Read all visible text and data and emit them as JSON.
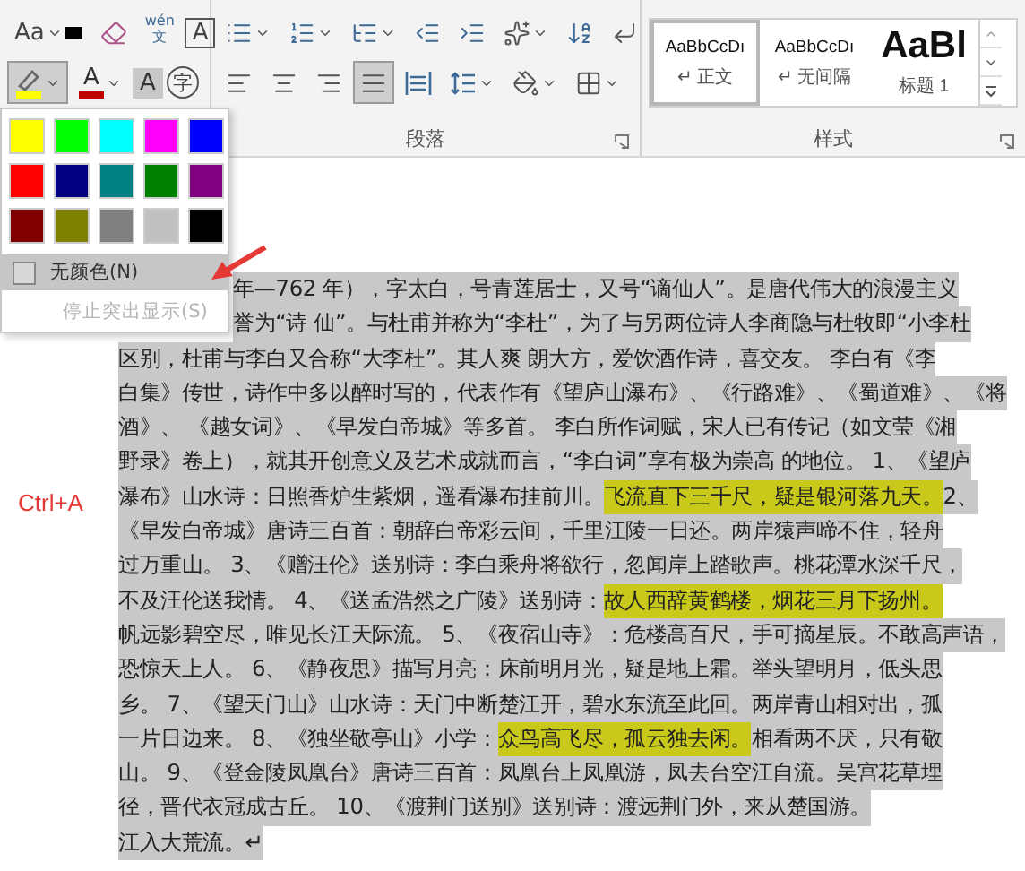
{
  "ribbon": {
    "font_rows": [
      [
        {
          "kind": "change-case",
          "label": "Aa"
        },
        {
          "kind": "clear-format"
        },
        {
          "kind": "phonetic",
          "label": "wén",
          "sub": "文"
        },
        {
          "kind": "boxed-letter",
          "label": "A"
        }
      ],
      [
        {
          "kind": "highlight",
          "pressed": true
        },
        {
          "kind": "font-color",
          "label": "A"
        },
        {
          "kind": "shaded-letter",
          "label": "A"
        },
        {
          "kind": "enclosed",
          "label": "字"
        }
      ]
    ],
    "paragraph_rows": [
      [
        {
          "kind": "bullets"
        },
        {
          "kind": "numbering"
        },
        {
          "kind": "multilevel"
        },
        {
          "kind": "outdent"
        },
        {
          "kind": "indent"
        },
        {
          "kind": "asian-layout"
        },
        {
          "kind": "sort"
        },
        {
          "kind": "marks"
        }
      ],
      [
        {
          "kind": "align-left",
          "selected": false
        },
        {
          "kind": "align-center",
          "selected": false
        },
        {
          "kind": "align-right",
          "selected": false
        },
        {
          "kind": "justify",
          "selected": true
        },
        {
          "kind": "distribute",
          "selected": false
        },
        {
          "kind": "line-spacing"
        },
        {
          "kind": "shading"
        },
        {
          "kind": "borders"
        }
      ]
    ],
    "paragraph_label": "段落",
    "styles": [
      {
        "preview": "AaBbCcDı",
        "name": "↵ 正文",
        "kind": "body",
        "selected": true
      },
      {
        "preview": "AaBbCcDı",
        "name": "↵ 无间隔",
        "kind": "body",
        "selected": false
      },
      {
        "preview": "AaBl",
        "name": "标题 1",
        "kind": "heading",
        "selected": false
      }
    ],
    "styles_label": "样式"
  },
  "highlight_menu": {
    "colors": [
      {
        "color": "#ffff00"
      },
      {
        "color": "#00ff00"
      },
      {
        "color": "#00ffff"
      },
      {
        "color": "#ff00ff"
      },
      {
        "color": "#0000ff"
      },
      {
        "color": "#ff0000"
      },
      {
        "color": "#000080"
      },
      {
        "color": "#008080"
      },
      {
        "color": "#008000"
      },
      {
        "color": "#800080"
      },
      {
        "color": "#800000"
      },
      {
        "color": "#808000"
      },
      {
        "color": "#808080"
      },
      {
        "color": "#c0c0c0"
      },
      {
        "color": "#000000"
      }
    ],
    "items": [
      {
        "label": "无颜色(N)",
        "kind": "no-color",
        "hovered": true,
        "disabled": false
      },
      {
        "label": "停止突出显示(S)",
        "kind": "stop",
        "hovered": false,
        "disabled": true
      }
    ]
  },
  "annotation": "Ctrl+A",
  "document": {
    "selected": true,
    "lines": [
      {
        "segments": [
          {
            "text": "年—762 年），字太白，号青莲居士，又号“谪仙人”。是唐代伟大的浪漫主义",
            "highlighted": false
          }
        ]
      },
      {
        "segments": [
          {
            "text": "誉为“诗 仙”。与杜甫并称为“李杜”，为了与另两位诗人李商隐与杜牧即“小李杜",
            "highlighted": false
          }
        ]
      },
      {
        "segments": [
          {
            "text": "区别，杜甫与李白又合称“大李杜”。其人爽 朗大方，爱饮酒作诗，喜交友。 李白有《李",
            "highlighted": false
          }
        ]
      },
      {
        "segments": [
          {
            "text": "白集》传世，诗作中多以醉时写的，代表作有《望庐山瀑布》、《行路难》、《蜀道难》、《将",
            "highlighted": false
          }
        ]
      },
      {
        "segments": [
          {
            "text": "酒》、 《越女词》、《早发白帝城》等多首。 李白所作词赋，宋人已有传记（如文莹《湘",
            "highlighted": false
          }
        ]
      },
      {
        "segments": [
          {
            "text": "野录》卷上），就其开创意义及艺术成就而言，“李白词”享有极为崇高 的地位。 1、《望庐",
            "highlighted": false
          }
        ]
      },
      {
        "segments": [
          {
            "text": "瀑布》山水诗：日照香炉生紫烟，遥看瀑布挂前川。",
            "highlighted": false
          },
          {
            "text": "飞流直下三千尺，疑是银河落九天。",
            "highlighted": true
          },
          {
            "text": " 2、",
            "highlighted": false
          }
        ]
      },
      {
        "segments": [
          {
            "text": "《早发白帝城》唐诗三百首：朝辞白帝彩云间，千里江陵一日还。两岸猿声啼不住，轻舟",
            "highlighted": false
          }
        ]
      },
      {
        "segments": [
          {
            "text": "过万重山。 3、《赠汪伦》送别诗：李白乘舟将欲行，忽闻岸上踏歌声。桃花潭水深千尺，",
            "highlighted": false
          }
        ]
      },
      {
        "segments": [
          {
            "text": "不及汪伦送我情。 4、《送孟浩然之广陵》送别诗：",
            "highlighted": false
          },
          {
            "text": "故人西辞黄鹤楼，烟花三月下扬州。",
            "highlighted": true
          }
        ]
      },
      {
        "segments": [
          {
            "text": "帆远影碧空尽，唯见长江天际流。 5、《夜宿山寺》：危楼高百尺，手可摘星辰。不敢高声语，",
            "highlighted": false
          }
        ]
      },
      {
        "segments": [
          {
            "text": "恐惊天上人。 6、《静夜思》描写月亮：床前明月光，疑是地上霜。举头望明月，低头思",
            "highlighted": false
          }
        ]
      },
      {
        "segments": [
          {
            "text": "乡。 7、《望天门山》山水诗：天门中断楚江开，碧水东流至此回。两岸青山相对出，孤",
            "highlighted": false
          }
        ]
      },
      {
        "segments": [
          {
            "text": "一片日边来。 8、《独坐敬亭山》小学：",
            "highlighted": false
          },
          {
            "text": "众鸟高飞尽，孤云独去闲。",
            "highlighted": true
          },
          {
            "text": "相看两不厌，只有敬",
            "highlighted": false
          }
        ]
      },
      {
        "segments": [
          {
            "text": "山。 9、《登金陵凤凰台》唐诗三百首：凤凰台上凤凰游，凤去台空江自流。吴宫花草埋",
            "highlighted": false
          }
        ]
      },
      {
        "segments": [
          {
            "text": "径，晋代衣冠成古丘。 10、《渡荆门送别》送别诗：渡远荆门外，来从楚国游。",
            "highlighted": false
          }
        ]
      },
      {
        "segments": [
          {
            "text": "江入大荒流。↵",
            "highlighted": false
          }
        ]
      }
    ]
  }
}
